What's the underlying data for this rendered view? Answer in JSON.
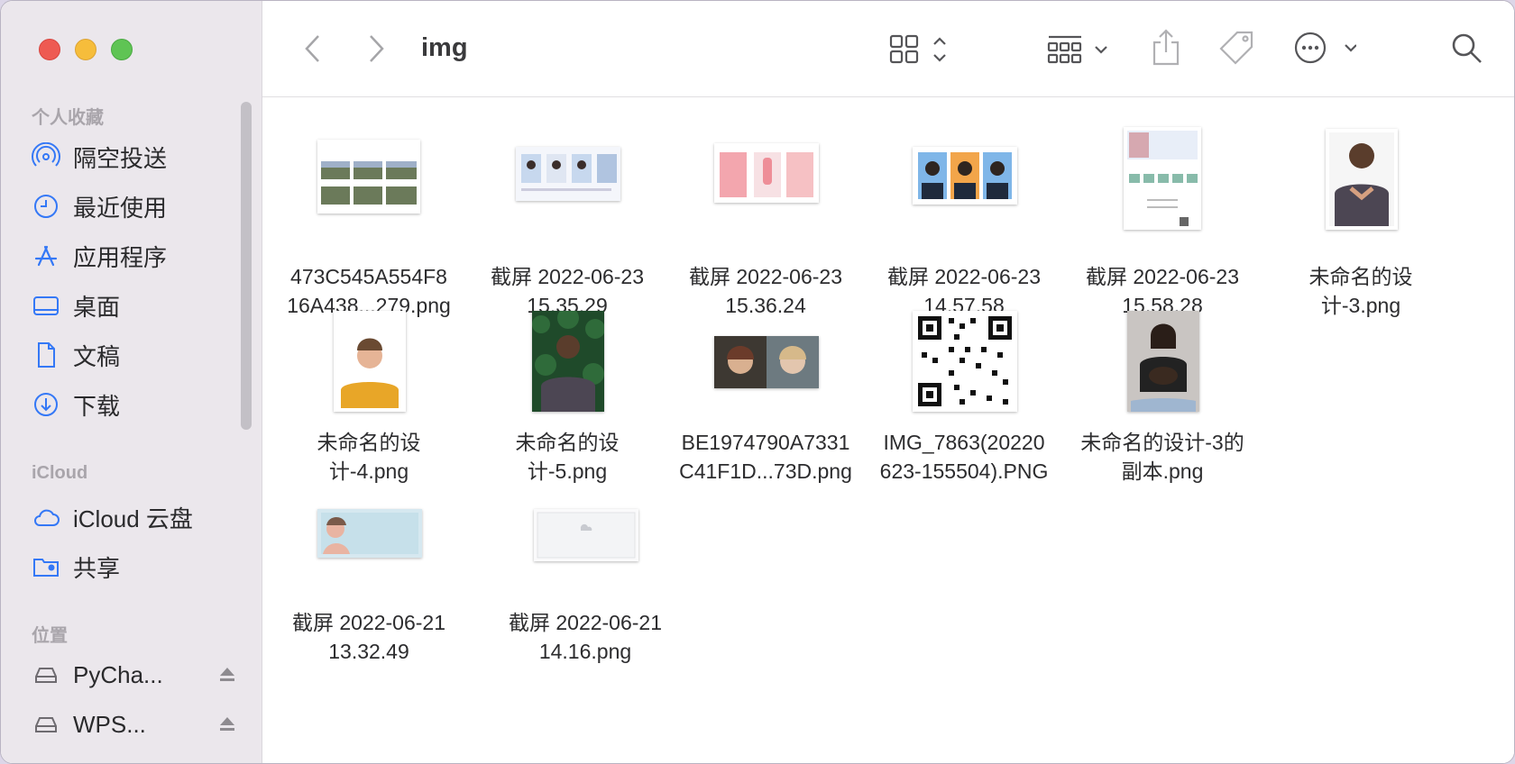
{
  "window": {
    "folder_title": "img"
  },
  "sidebar": {
    "sections": [
      {
        "title": "个人收藏"
      },
      {
        "title": "iCloud"
      },
      {
        "title": "位置"
      }
    ],
    "favorites": [
      {
        "label": "隔空投送",
        "icon": "airdrop-icon"
      },
      {
        "label": "最近使用",
        "icon": "clock-icon"
      },
      {
        "label": "应用程序",
        "icon": "applications-icon"
      },
      {
        "label": "桌面",
        "icon": "desktop-icon"
      },
      {
        "label": "文稿",
        "icon": "document-icon"
      },
      {
        "label": "下载",
        "icon": "download-icon"
      }
    ],
    "icloud": [
      {
        "label": "iCloud 云盘",
        "icon": "cloud-icon"
      },
      {
        "label": "共享",
        "icon": "shared-folder-icon"
      }
    ],
    "locations": [
      {
        "label": "PyCha...",
        "icon": "drive-icon"
      },
      {
        "label": "WPS...",
        "icon": "drive-icon"
      }
    ]
  },
  "files": [
    {
      "name": "473C545A554F8\n16A438...279.png"
    },
    {
      "name": "截屏 2022-06-23\n15.35.29"
    },
    {
      "name": "截屏 2022-06-23\n15.36.24"
    },
    {
      "name": "截屏 2022-06-23\n14.57.58"
    },
    {
      "name": "截屏 2022-06-23\n15.58.28"
    },
    {
      "name": "未命名的设\n计-3.png"
    },
    {
      "name": "未命名的设\n计-4.png"
    },
    {
      "name": "未命名的设\n计-5.png"
    },
    {
      "name": "BE1974790A7331\nC41F1D...73D.png"
    },
    {
      "name": "IMG_7863(20220\n623-155504).PNG"
    },
    {
      "name": "未命名的设计-3的\n副本.png"
    },
    {
      "name": "截屏 2022-06-21\n13.32.49"
    },
    {
      "name": "截屏 2022-06-21\n14.16.png"
    }
  ],
  "colors": {
    "sidebar_bg": "#ebe7ec",
    "accent": "#3478f6"
  }
}
